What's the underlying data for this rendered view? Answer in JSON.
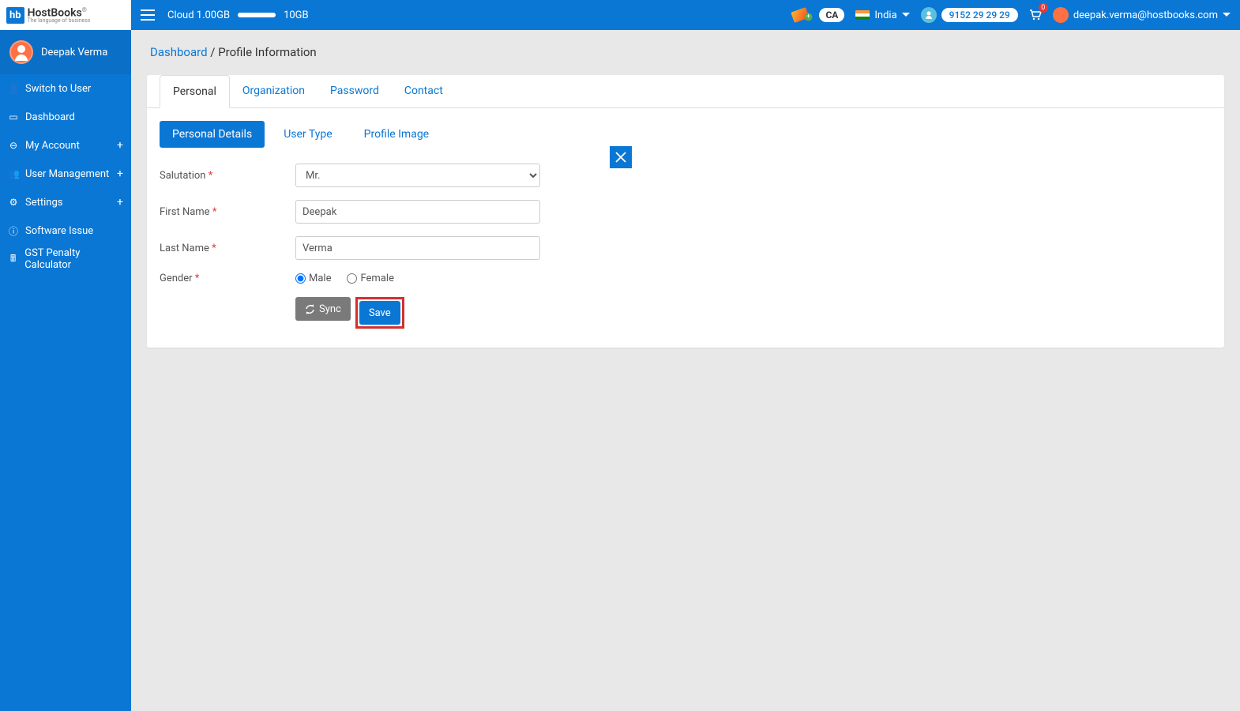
{
  "logo": {
    "badge": "hb",
    "name": "HostBooks",
    "tagline": "The language of business",
    "reg": "®"
  },
  "header": {
    "cloud_used": "Cloud 1.00GB",
    "cloud_total": "10GB",
    "ca_label": "CA",
    "country": "India",
    "phone": "9152 29 29 29",
    "cart_count": "0",
    "email": "deepak.verma@hostbooks.com"
  },
  "sidebar": {
    "user_name": "Deepak Verma",
    "items": [
      {
        "label": "Switch to User",
        "icon": "👤",
        "plus": false
      },
      {
        "label": "Dashboard",
        "icon": "▭",
        "plus": false
      },
      {
        "label": "My Account",
        "icon": "⊖",
        "plus": true
      },
      {
        "label": "User Management",
        "icon": "👥",
        "plus": true
      },
      {
        "label": "Settings",
        "icon": "⚙",
        "plus": true
      },
      {
        "label": "Software Issue",
        "icon": "ⓘ",
        "plus": false
      },
      {
        "label": "GST Penalty Calculator",
        "icon": "🖩",
        "plus": false
      }
    ]
  },
  "breadcrumb": {
    "root": "Dashboard",
    "sep": " / ",
    "current": "Profile Information"
  },
  "main_tabs": [
    "Personal",
    "Organization",
    "Password",
    "Contact"
  ],
  "sub_tabs": [
    "Personal Details",
    "User Type",
    "Profile Image"
  ],
  "form": {
    "salutation_label": "Salutation",
    "salutation_value": "Mr.",
    "first_name_label": "First Name",
    "first_name_value": "Deepak",
    "last_name_label": "Last Name",
    "last_name_value": "Verma",
    "gender_label": "Gender",
    "gender_male": "Male",
    "gender_female": "Female",
    "sync_label": "Sync",
    "save_label": "Save"
  }
}
